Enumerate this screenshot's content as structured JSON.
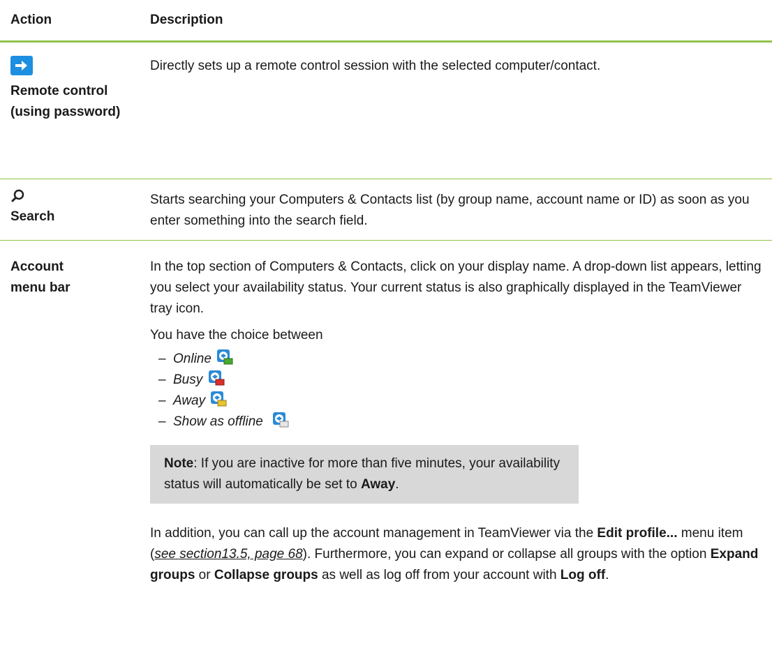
{
  "header": {
    "action_label": "Action",
    "description_label": "Description"
  },
  "rows": [
    {
      "icon": "arrow-right-icon",
      "action": "Remote control (using password)",
      "description": "Directly sets up a remote control session with the selected computer/contact."
    },
    {
      "icon": "search-icon",
      "action": "Search",
      "description": "Starts searching your Computers & Contacts list (by group name, account name or ID) as soon as you enter something into the search field."
    },
    {
      "action": "Account menu bar",
      "intro": "In the top section of Computers & Contacts, click on your display name. A drop-down list appears, letting you select your availability status. Your current status is also graphically displayed in the TeamViewer tray icon.",
      "choice_text": "You have the choice between",
      "statuses": [
        {
          "label": "Online",
          "icon": "teamviewer-online-icon",
          "color": "#4aa832"
        },
        {
          "label": "Busy",
          "icon": "teamviewer-busy-icon",
          "color": "#d9302a"
        },
        {
          "label": "Away",
          "icon": "teamviewer-away-icon",
          "color": "#e8c332"
        },
        {
          "label": "Show as offline",
          "icon": "teamviewer-offline-icon",
          "color": "#e6e6e6"
        }
      ],
      "note": {
        "label": "Note",
        "text_before": ": If you are inactive for more than five minutes, your availability status will automatically be set to ",
        "bold_end": "Away",
        "text_after": "."
      },
      "addition": {
        "p1": "In addition, you can call up the account management in TeamViewer via the ",
        "b1": "Edit profile...",
        "p2": " menu item (",
        "link": "see section13.5, page 68",
        "p3": "). Furthermore, you can expand or collapse all groups with the option ",
        "b2": "Expand groups",
        "p4": " or ",
        "b3": "Collapse groups",
        "p5": " as well as log off from your account with ",
        "b4": "Log off",
        "p6": "."
      }
    }
  ],
  "colors": {
    "accent_green": "#92c24b",
    "note_bg": "#d8d8d8",
    "icon_blue": "#1d8fe0"
  }
}
